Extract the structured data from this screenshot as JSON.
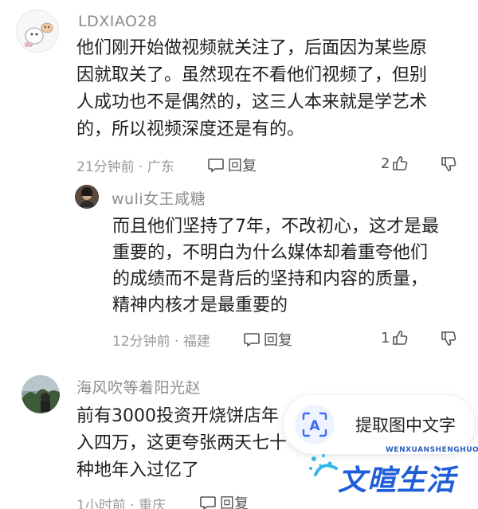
{
  "comments": [
    {
      "username": "LDXIAO28",
      "lines": [
        "他们刚开始做视频就关注了，后面因为某些原",
        "因就取关了。虽然现在不看他们视频了，但别",
        "人成功也不是偶然的，这三人本来就是学艺术",
        "的，所以视频深度还是有的。"
      ],
      "time_location": "21分钟前 · 广东",
      "reply_label": "回复",
      "likes": "2"
    },
    {
      "username": "wuli女王咸糖",
      "lines": [
        "而且他们坚持了7年，不改初心，这才是最",
        "重要的，不明白为什么媒体却着重夸他们",
        "的成绩而不是背后的坚持和内容的质量，",
        "精神内核才是最重要的"
      ],
      "time_location": "12分钟前 · 福建",
      "reply_label": "回复",
      "likes": "1"
    },
    {
      "username": "海风吹等着阳光赵",
      "lines": [
        "前有3000投资开烧饼店年",
        "入四万，这更夸张两天七十",
        "种地年入过亿了"
      ],
      "time_location": "1小时前 · 重庆",
      "reply_label": "回复"
    }
  ],
  "ocr_button": {
    "label": "提取图中文字",
    "icon": "A"
  },
  "watermark": {
    "small": "WENXUANSHENGHUO",
    "big": "文暄生活"
  },
  "icons": {
    "reply": "speech-bubble-icon",
    "like": "thumbs-up-icon",
    "dislike": "thumbs-down-icon"
  },
  "colors": {
    "accent": "#1f5ed8",
    "meta": "#9a9a9a",
    "username": "#8c8c8c"
  }
}
